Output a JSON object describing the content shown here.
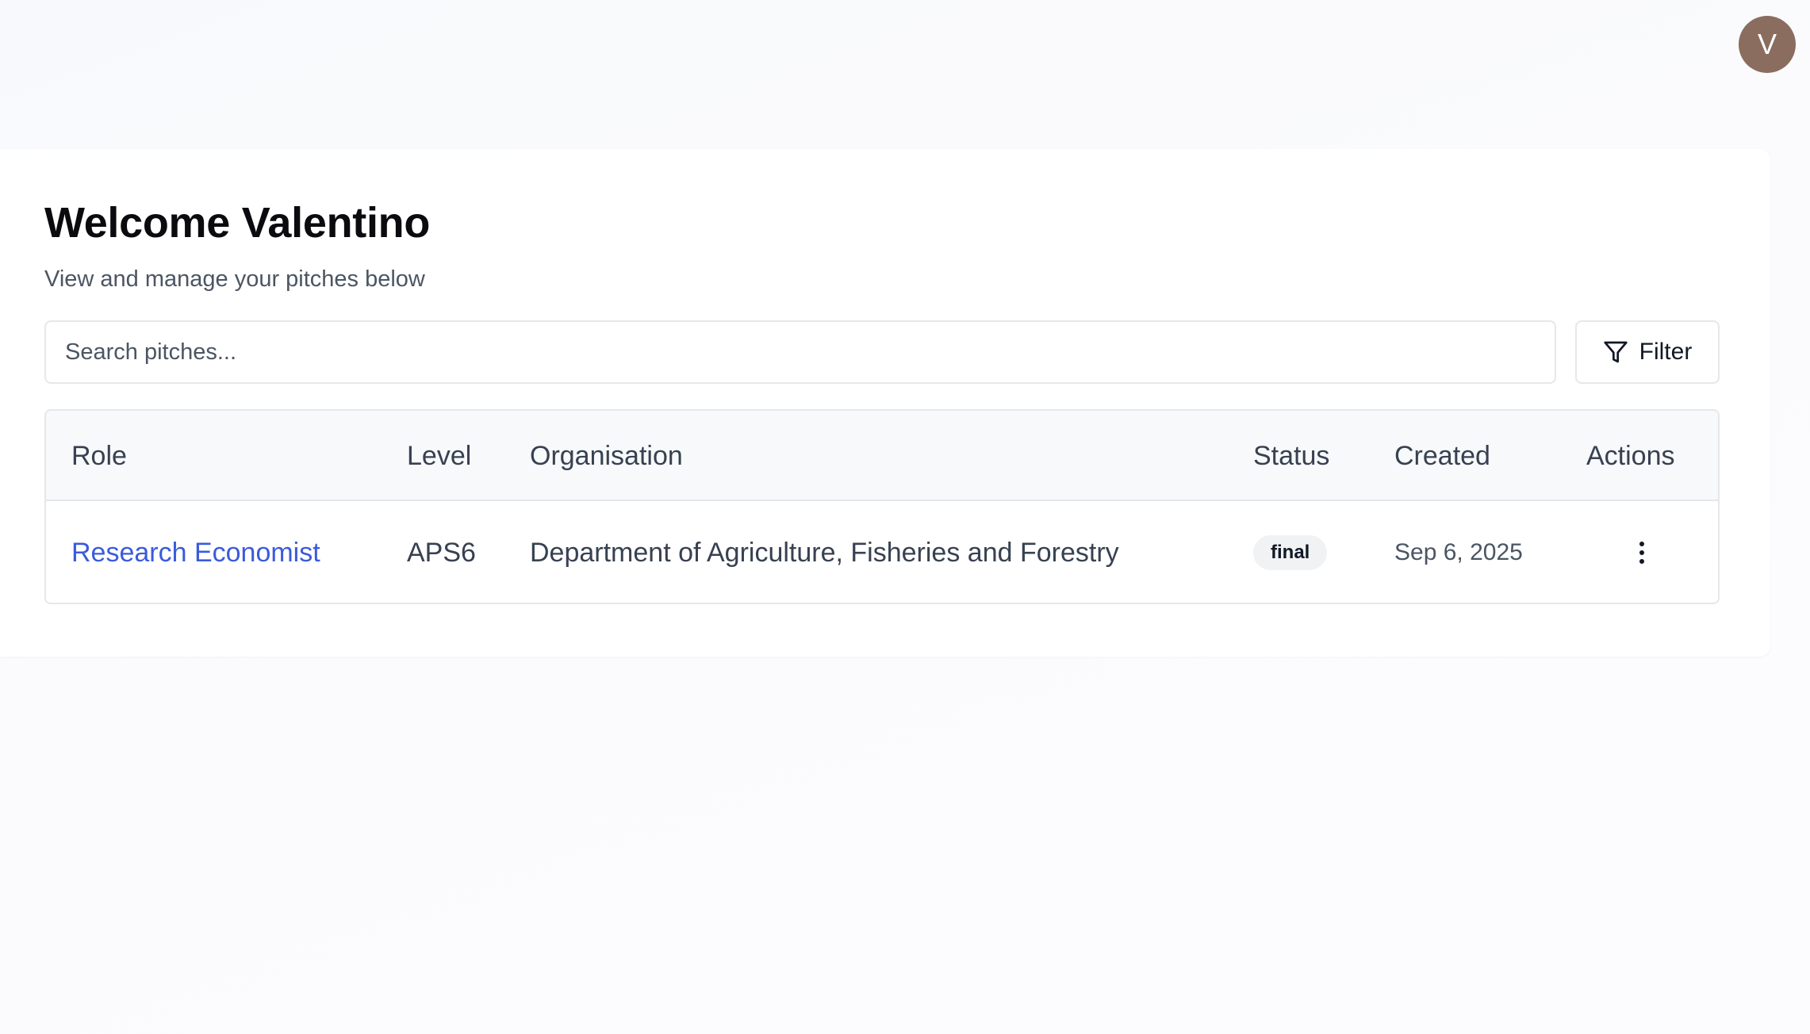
{
  "user": {
    "avatar_initial": "V"
  },
  "header": {
    "title": "Welcome Valentino",
    "subtitle": "View and manage your pitches below"
  },
  "search": {
    "placeholder": "Search pitches...",
    "value": ""
  },
  "filter": {
    "label": "Filter",
    "icon": "filter-icon"
  },
  "table": {
    "columns": [
      "Role",
      "Level",
      "Organisation",
      "Status",
      "Created",
      "Actions"
    ],
    "rows": [
      {
        "role": "Research Economist",
        "level": "APS6",
        "organisation": "Department of Agriculture, Fisheries and Forestry",
        "status": "final",
        "created": "Sep 6, 2025",
        "actions_icon": "more-vertical-icon"
      }
    ]
  },
  "colors": {
    "link": "#3b5bdb",
    "avatar_bg": "#8a6d5f",
    "badge_bg": "#f1f2f4"
  }
}
